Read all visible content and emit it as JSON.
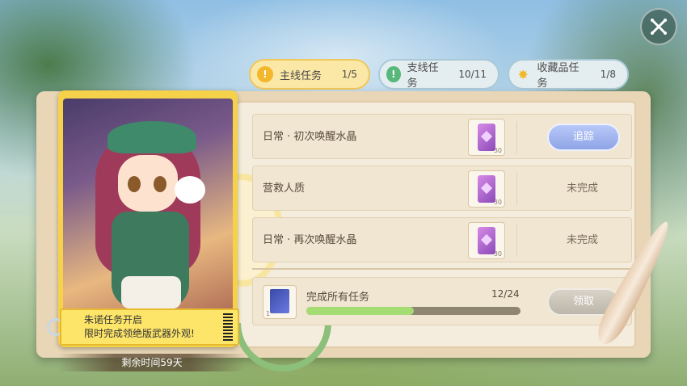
{
  "close_button": {
    "icon": "close-icon"
  },
  "tabs": [
    {
      "label": "主线任务",
      "count": "1/5",
      "icon": "exclamation-icon",
      "active": true
    },
    {
      "label": "支线任务",
      "count": "10/11",
      "icon": "exclamation-icon",
      "active": false
    },
    {
      "label": "收藏品任务",
      "count": "1/8",
      "icon": "star-icon",
      "active": false
    }
  ],
  "banner": {
    "line1": "朱诺任务开启",
    "line2": "限时完成领绝版武器外观!"
  },
  "timer": "剩余时间59天",
  "tasks": [
    {
      "name": "日常 · 初次唤醒水晶",
      "reward_qty": "30",
      "status": "追踪",
      "action": true
    },
    {
      "name": "营救人质",
      "reward_qty": "30",
      "status": "未完成",
      "action": false
    },
    {
      "name": "日常 · 再次唤醒水晶",
      "reward_qty": "30",
      "status": "未完成",
      "action": false
    }
  ],
  "total": {
    "name": "完成所有任务",
    "count": "12/24",
    "progress": 0.5,
    "reward_qty": "1",
    "button": "领取"
  },
  "colors": {
    "tab_main": "#fbe8a6",
    "track_button": "#8ea4e6",
    "progress_fill": "#a6dc74"
  }
}
